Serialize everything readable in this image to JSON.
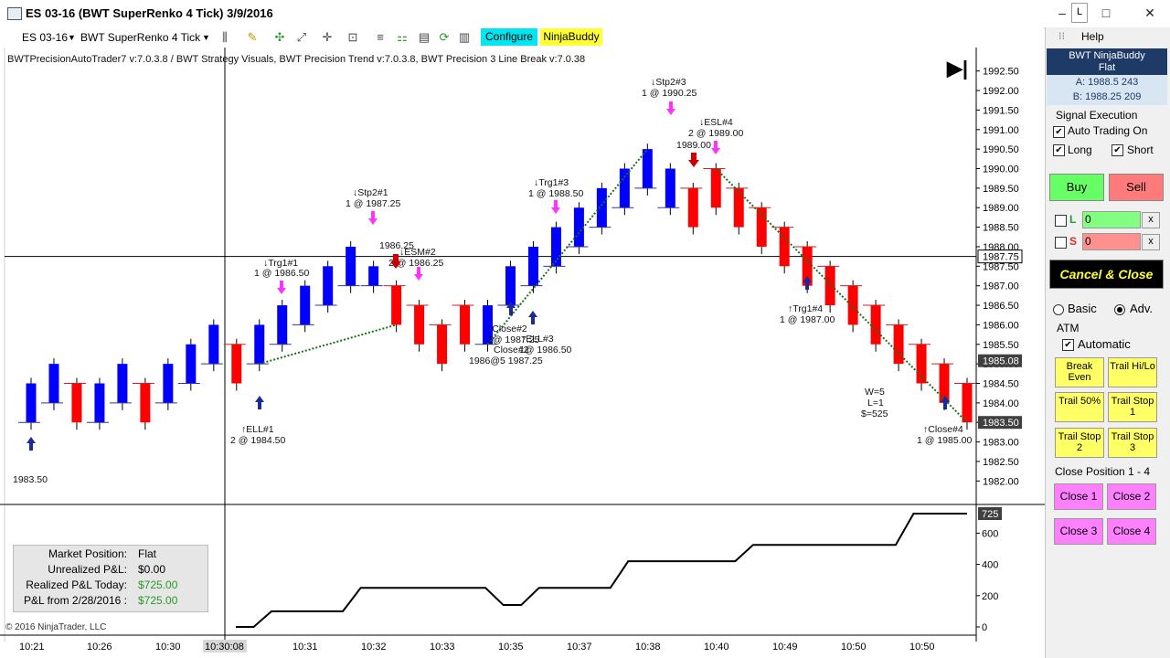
{
  "window": {
    "title": "ES 03-16 (BWT SuperRenko  4 Tick)  3/9/2016",
    "minimize": "–",
    "maximize": "□",
    "close": "✕",
    "pin": "L"
  },
  "toolbar": {
    "instrument": "ES 03-16",
    "period": "BWT SuperRenko  4 Tick",
    "configure": "Configure",
    "ninjabuddy": "NinjaBuddy",
    "configure_color": "#00e6f0",
    "ninjabuddy_color": "#ffff33"
  },
  "chart": {
    "indicators": "BWTPrecisionAutoTrader7 v:7.0.3.8 / BWT Strategy Visuals, BWT Precision Trend v:7.0.3.8, BWT Precision 3 Line Break v:7.0.38",
    "price_ticks": [
      "1992.50",
      "1992.00",
      "1991.50",
      "1991.00",
      "1990.50",
      "1990.00",
      "1989.50",
      "1989.00",
      "1988.50",
      "1988.00",
      "1987.50",
      "1987.00",
      "1986.50",
      "1986.00",
      "1985.50",
      "1985.00",
      "1984.50",
      "1984.00",
      "1983.50",
      "1983.00",
      "1982.50",
      "1982.00"
    ],
    "crosshair_price": "1987.75",
    "marker_price_1": "1985.08",
    "marker_price_2": "1983.50",
    "pnl_ticks": [
      "600",
      "400",
      "200",
      "0"
    ],
    "pnl_marker": "725",
    "time_ticks": [
      "10:21",
      "10:26",
      "10:30",
      "10:31",
      "10:32",
      "10:33",
      "10:35",
      "10:37",
      "10:38",
      "10:40",
      "10:49",
      "10:50",
      "10:50"
    ],
    "crosshair_time": "10:30:08",
    "copyright": "© 2016 NinjaTrader, LLC",
    "annotations": [
      {
        "id": "a1",
        "text": "1983.50"
      },
      {
        "id": "a2",
        "text": "↑ELL#1"
      },
      {
        "id": "a3",
        "text": "2 @ 1984.50"
      },
      {
        "id": "a4",
        "text": "↓Trg1#1"
      },
      {
        "id": "a5",
        "text": "1 @ 1986.50"
      },
      {
        "id": "a6",
        "text": "↓Stp2#1"
      },
      {
        "id": "a7",
        "text": "1 @ 1987.25"
      },
      {
        "id": "a8",
        "text": "1986.25"
      },
      {
        "id": "a9",
        "text": "↓ESM#2"
      },
      {
        "id": "a10",
        "text": "2 @ 1986.25"
      },
      {
        "id": "a11",
        "text": "↑Close#2"
      },
      {
        "id": "a12",
        "text": "1@ 1987.25"
      },
      {
        "id": "a13",
        "text": "↑ELL#3"
      },
      {
        "id": "a14",
        "text": "1@ 1986.50"
      },
      {
        "id": "a15",
        "text": "Close#2"
      },
      {
        "id": "a16",
        "text": "1986@5 1987.25"
      },
      {
        "id": "a17",
        "text": "↓Trg1#3"
      },
      {
        "id": "a18",
        "text": "1 @ 1988.50"
      },
      {
        "id": "a19",
        "text": "↓Stp2#3"
      },
      {
        "id": "a20",
        "text": "1 @ 1990.25"
      },
      {
        "id": "a21",
        "text": "↓ESL#4"
      },
      {
        "id": "a22",
        "text": "2 @ 1989.00"
      },
      {
        "id": "a23",
        "text": "1989.00"
      },
      {
        "id": "a24",
        "text": "↑Trg1#4"
      },
      {
        "id": "a25",
        "text": "1 @ 1987.00"
      },
      {
        "id": "a26",
        "text": "W=5"
      },
      {
        "id": "a27",
        "text": "L=1"
      },
      {
        "id": "a28",
        "text": "$=525"
      },
      {
        "id": "a29",
        "text": "↑Close#4"
      },
      {
        "id": "a30",
        "text": "1 @ 1985.00"
      }
    ],
    "pnl_box": {
      "market_position_label": "Market Position:",
      "market_position": "Flat",
      "unrealized_label": "Unrealized P&L:",
      "unrealized": "$0.00",
      "realized_label": "Realized P&L Today:",
      "realized": "$725.00",
      "from_label": "P&L from 2/28/2016 :",
      "from": "$725.00"
    }
  },
  "chart_data": {
    "type": "renko",
    "up_color": "#0000ff",
    "down_color": "#ff0000",
    "bricks": [
      {
        "dir": "up",
        "open": 1983.5,
        "close": 1984.5
      },
      {
        "dir": "up",
        "open": 1984.0,
        "close": 1985.0
      },
      {
        "dir": "down",
        "open": 1984.5,
        "close": 1983.5
      },
      {
        "dir": "up",
        "open": 1983.5,
        "close": 1984.5
      },
      {
        "dir": "up",
        "open": 1984.0,
        "close": 1985.0
      },
      {
        "dir": "down",
        "open": 1984.5,
        "close": 1983.5
      },
      {
        "dir": "up",
        "open": 1984.0,
        "close": 1985.0
      },
      {
        "dir": "up",
        "open": 1984.5,
        "close": 1985.5
      },
      {
        "dir": "up",
        "open": 1985.0,
        "close": 1986.0
      },
      {
        "dir": "down",
        "open": 1985.5,
        "close": 1984.5
      },
      {
        "dir": "up",
        "open": 1985.0,
        "close": 1986.0
      },
      {
        "dir": "up",
        "open": 1985.5,
        "close": 1986.5
      },
      {
        "dir": "up",
        "open": 1986.0,
        "close": 1987.0
      },
      {
        "dir": "up",
        "open": 1986.5,
        "close": 1987.5
      },
      {
        "dir": "up",
        "open": 1987.0,
        "close": 1988.0
      },
      {
        "dir": "up",
        "open": 1987.0,
        "close": 1987.5
      },
      {
        "dir": "down",
        "open": 1987.0,
        "close": 1986.0
      },
      {
        "dir": "down",
        "open": 1986.5,
        "close": 1985.5
      },
      {
        "dir": "down",
        "open": 1986.0,
        "close": 1985.0
      },
      {
        "dir": "down",
        "open": 1986.5,
        "close": 1985.5
      },
      {
        "dir": "up",
        "open": 1985.5,
        "close": 1986.5
      },
      {
        "dir": "up",
        "open": 1986.5,
        "close": 1987.5
      },
      {
        "dir": "up",
        "open": 1987.0,
        "close": 1988.0
      },
      {
        "dir": "up",
        "open": 1987.5,
        "close": 1988.5
      },
      {
        "dir": "up",
        "open": 1988.0,
        "close": 1989.0
      },
      {
        "dir": "up",
        "open": 1988.5,
        "close": 1989.5
      },
      {
        "dir": "up",
        "open": 1989.0,
        "close": 1990.0
      },
      {
        "dir": "up",
        "open": 1989.5,
        "close": 1990.5
      },
      {
        "dir": "up",
        "open": 1989.0,
        "close": 1990.0
      },
      {
        "dir": "down",
        "open": 1989.5,
        "close": 1988.5
      },
      {
        "dir": "down",
        "open": 1990.0,
        "close": 1989.0
      },
      {
        "dir": "down",
        "open": 1989.5,
        "close": 1988.5
      },
      {
        "dir": "down",
        "open": 1989.0,
        "close": 1988.0
      },
      {
        "dir": "down",
        "open": 1988.5,
        "close": 1987.5
      },
      {
        "dir": "down",
        "open": 1988.0,
        "close": 1987.0
      },
      {
        "dir": "down",
        "open": 1987.5,
        "close": 1986.5
      },
      {
        "dir": "down",
        "open": 1987.0,
        "close": 1986.0
      },
      {
        "dir": "down",
        "open": 1986.5,
        "close": 1985.5
      },
      {
        "dir": "down",
        "open": 1986.0,
        "close": 1985.0
      },
      {
        "dir": "down",
        "open": 1985.5,
        "close": 1984.5
      },
      {
        "dir": "down",
        "open": 1985.0,
        "close": 1984.0
      },
      {
        "dir": "down",
        "open": 1984.5,
        "close": 1983.5
      }
    ],
    "pnl_curve": [
      0,
      0,
      100,
      100,
      100,
      100,
      100,
      250,
      250,
      250,
      250,
      250,
      250,
      250,
      250,
      140,
      140,
      250,
      250,
      250,
      250,
      250,
      420,
      420,
      420,
      420,
      420,
      420,
      420,
      525,
      525,
      525,
      525,
      525,
      525,
      525,
      525,
      525,
      725,
      725,
      725,
      725
    ],
    "price_range": [
      1981.75,
      1992.75
    ],
    "pnl_range": [
      0,
      725
    ]
  },
  "panel": {
    "help": "Help",
    "acct_title": "BWT NinjaBuddy",
    "acct_sub": "Flat",
    "ask": "A: 1988.5 243",
    "bid": "B: 1988.25 209",
    "signal_execution": "Signal Execution",
    "auto_trading": "Auto Trading On",
    "long": "Long",
    "short": "Short",
    "buy": "Buy",
    "sell": "Sell",
    "l_label": "L",
    "l_value": "0",
    "s_label": "S",
    "s_value": "0",
    "x": "x",
    "cancel_close": "Cancel & Close",
    "basic": "Basic",
    "adv": "Adv.",
    "atm": "ATM",
    "automatic": "Automatic",
    "break_even": "Break Even",
    "trail_hilo": "Trail Hi/Lo",
    "trail_50": "Trail 50%",
    "trail_stop1": "Trail Stop 1",
    "trail_stop2": "Trail Stop 2",
    "trail_stop3": "Trail Stop 3",
    "close_position": "Close Position 1 - 4",
    "close1": "Close 1",
    "close2": "Close 2",
    "close3": "Close 3",
    "close4": "Close 4",
    "buy_color": "#66ff66",
    "sell_color": "#ff7a7a",
    "cancel_color": "#000000"
  }
}
